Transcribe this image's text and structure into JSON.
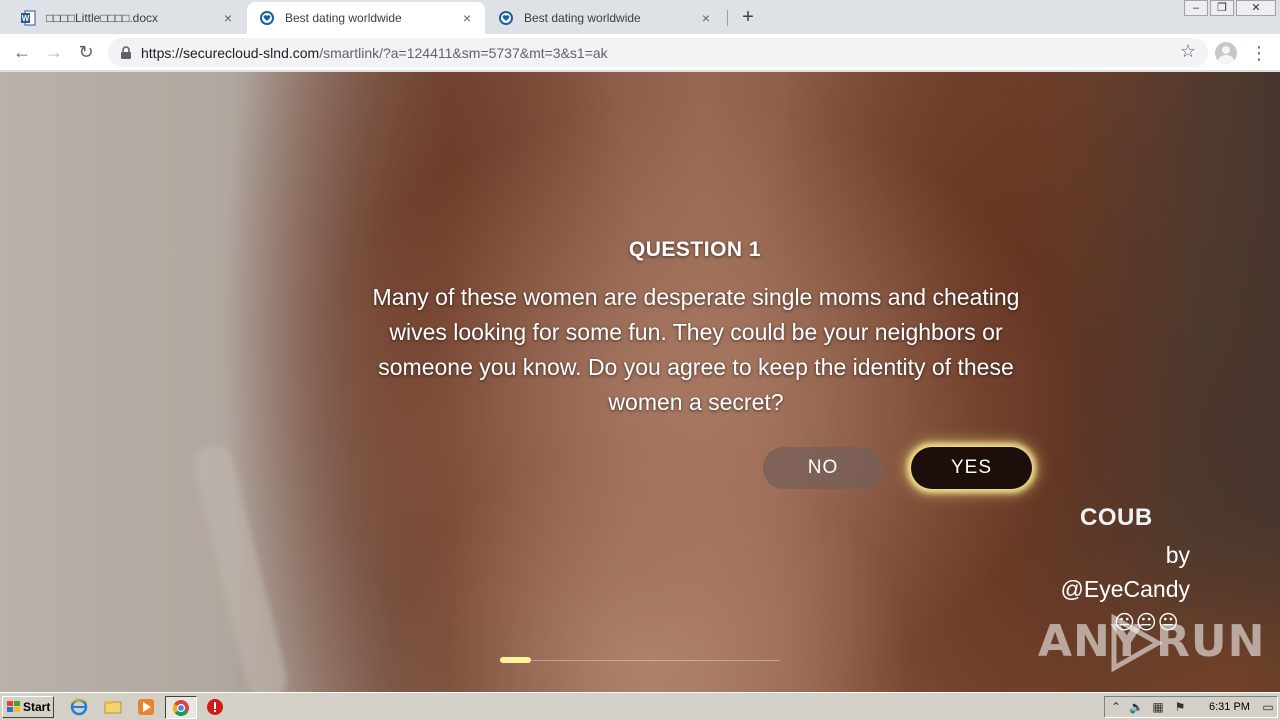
{
  "browser": {
    "tabs": [
      {
        "title": "□□□□Little□□□□.docx",
        "favicon": "word-doc-icon",
        "active": false
      },
      {
        "title": "Best dating worldwide",
        "favicon": "heart-shield-icon",
        "active": true
      },
      {
        "title": "Best dating worldwide",
        "favicon": "heart-shield-icon",
        "active": false
      }
    ],
    "new_tab_symbol": "+",
    "url_host": "https://securecloud-slnd.com",
    "url_path": "/smartlink/?a=124411&sm=5737&mt=3&s1=ak",
    "close_symbol": "×"
  },
  "page": {
    "question_title": "QUESTION 1",
    "question_text": "Many of these women are desperate single moms and cheating wives looking for some fun. They could be your neighbors or someone you know. Do you agree to keep the identity of these women a secret?",
    "no_label": "NO",
    "yes_label": "YES",
    "coub_brand": "COUB",
    "coub_by": "by",
    "coub_user": "@EyeCandy",
    "coub_emojis": "😐😐😐",
    "progress_fraction": 0.11,
    "accent_color": "#fff59a"
  },
  "watermark": {
    "left": "ANY",
    "right": "RUN"
  },
  "taskbar": {
    "start_label": "Start",
    "clock": "6:31 PM",
    "pinned": [
      "ie-icon",
      "folder-icon",
      "media-player-icon",
      "chrome-icon",
      "stop-icon"
    ]
  }
}
